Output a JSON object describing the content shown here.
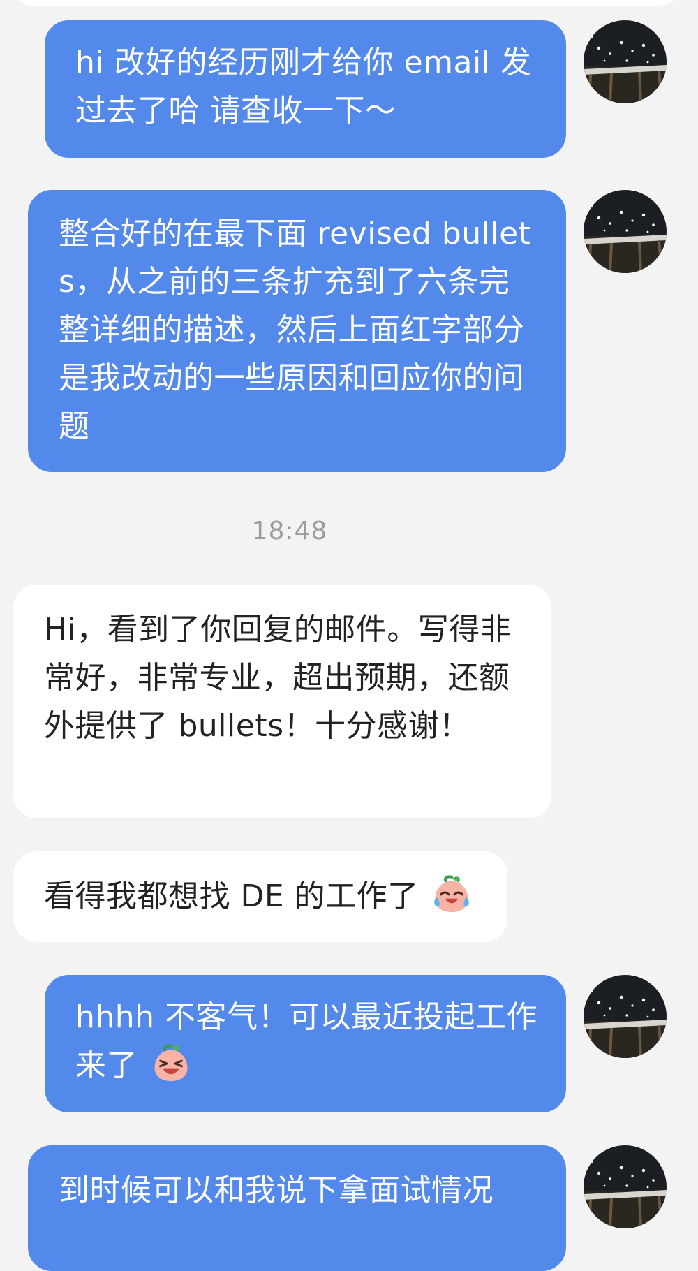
{
  "messages": [
    {
      "direction": "outgoing",
      "text": "hi 改好的经历刚才给你 email 发过去了哈 请查收一下～"
    },
    {
      "direction": "outgoing",
      "text": "整合好的在最下面 revised bullets，从之前的三条扩充到了六条完整详细的描述，然后上面红字部分是我改动的一些原因和回应你的问题"
    },
    {
      "direction": "timestamp",
      "text": "18:48"
    },
    {
      "direction": "incoming",
      "text": "Hi，看到了你回复的邮件。写得非常好，非常专业，超出预期，还额外提供了 bullets！十分感谢！"
    },
    {
      "direction": "incoming",
      "text": "看得我都想找 DE 的工作了",
      "emoji": "crying-laughing-peach-emoji"
    },
    {
      "direction": "outgoing",
      "text": "hhhh 不客气！可以最近投起工作来了",
      "emoji": "laughing-peach-emoji"
    },
    {
      "direction": "outgoing",
      "text": "到时候可以和我说下拿面试情况"
    }
  ],
  "colors": {
    "background": "#f3f3f3",
    "outgoing_bubble": "#5289ea",
    "incoming_bubble": "#ffffff",
    "timestamp_text": "#9b9b9b"
  }
}
